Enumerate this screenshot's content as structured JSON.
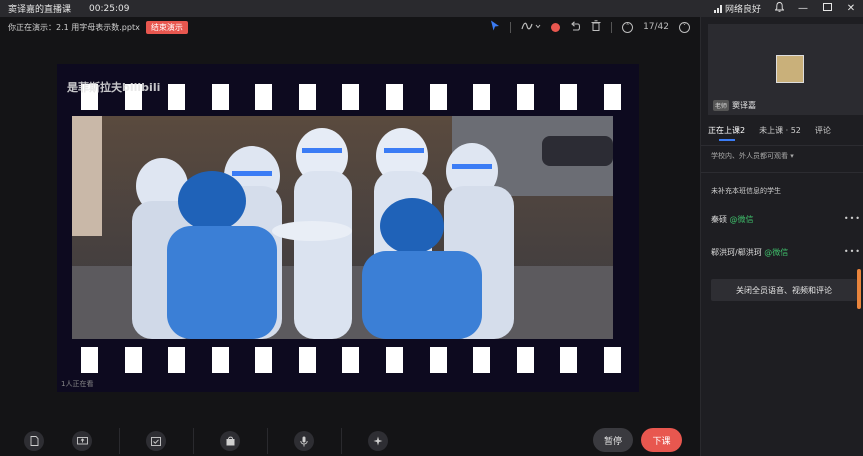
{
  "titlebar": {
    "title": "窦译嘉的直播课",
    "timer": "00:25:09",
    "network": "网络良好"
  },
  "topbar": {
    "presenting": "你正在演示：2.1 用字母表示数.pptx",
    "end_presentation": "结束演示",
    "page_counter": "17/42"
  },
  "slide": {
    "watermark": "是菲斯拉夫bilibili",
    "viewers": "1人正在看"
  },
  "controls": {
    "pause": "暂停",
    "leave": "下课"
  },
  "sidebar": {
    "teacher_badge": "老师",
    "teacher_name": "窦译嘉",
    "tabs": [
      {
        "label": "正在上课2"
      },
      {
        "label": "未上课 · 52"
      },
      {
        "label": "评论"
      }
    ],
    "visibility": "学校内、外人员都可观看",
    "section_title": "未补充本班信息的学生",
    "students": [
      {
        "name": "秦硕",
        "source": "@微信"
      },
      {
        "name": "郗洪珂/郗洪珂",
        "source": "@微信"
      }
    ],
    "mute_all": "关闭全员语音、视频和评论"
  },
  "colors": {
    "accent_red": "#e8574f",
    "tab_underline": "#3b7cf5",
    "wechat_green": "#3fbf6b",
    "scrollbar": "#e8843c"
  },
  "icons": [
    "signal-bars-icon",
    "bell-icon",
    "minimize-icon",
    "maximize-icon",
    "close-icon",
    "pointer-icon",
    "pen-icon",
    "record-icon",
    "undo-icon",
    "trash-icon",
    "page-up-icon",
    "page-down-icon",
    "document-icon",
    "screen-share-icon",
    "checkin-icon",
    "bag-icon",
    "microphone-icon",
    "sparkle-icon"
  ]
}
